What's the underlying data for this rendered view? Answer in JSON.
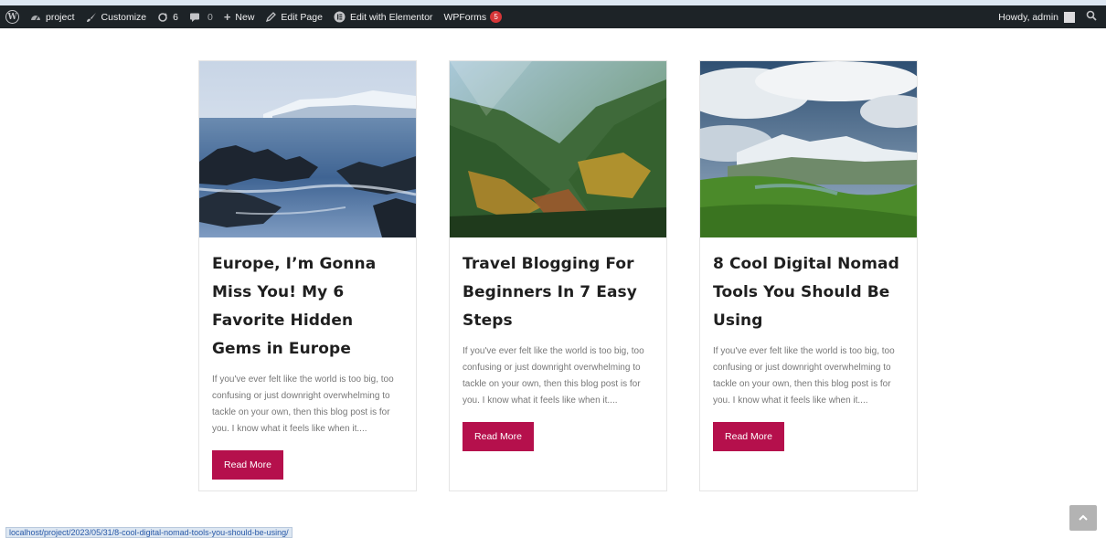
{
  "admin_bar": {
    "site_name": "project",
    "customize": "Customize",
    "updates_count": "6",
    "comments_count": "0",
    "new": "New",
    "edit_page": "Edit Page",
    "elementor": "Edit with Elementor",
    "wpforms": "WPForms",
    "wpforms_badge": "5",
    "howdy": "Howdy, admin",
    "icons": [
      "wordpress-logo-icon",
      "dashboard-icon",
      "brush-icon",
      "updates-icon",
      "comment-icon",
      "plus-icon",
      "pencil-icon",
      "elementor-icon",
      "search-icon"
    ]
  },
  "posts": [
    {
      "title": "Europe, I’m Gonna Miss You! My 6 Favorite Hidden Gems in Europe",
      "excerpt": "If you've ever felt like the world is too big, too confusing or just downright overwhelming to tackle on your own, then this blog post is for you. I know what it feels like when it....",
      "button": "Read More",
      "image": "rocky-coast"
    },
    {
      "title": "Travel Blogging For Beginners In 7 Easy Steps",
      "excerpt": "If you've ever felt like the world is too big, too confusing or just downright overwhelming to tackle on your own, then this blog post is for you. I know what it feels like when it....",
      "button": "Read More",
      "image": "forest-valley"
    },
    {
      "title": "8 Cool Digital Nomad Tools You Should Be Using",
      "excerpt": "If you've ever felt like the world is too big, too confusing or just downright overwhelming to tackle on your own, then this blog post is for you. I know what it feels like when it....",
      "button": "Read More",
      "image": "mountain-meadow"
    }
  ],
  "status_url": "localhost/project/2023/05/31/8-cool-digital-nomad-tools-you-should-be-using/",
  "colors": {
    "admin_bar_bg": "#1d2327",
    "button_bg": "#b5104c",
    "badge_bg": "#d63638",
    "scroll_top_bg": "#b3b3b3"
  }
}
